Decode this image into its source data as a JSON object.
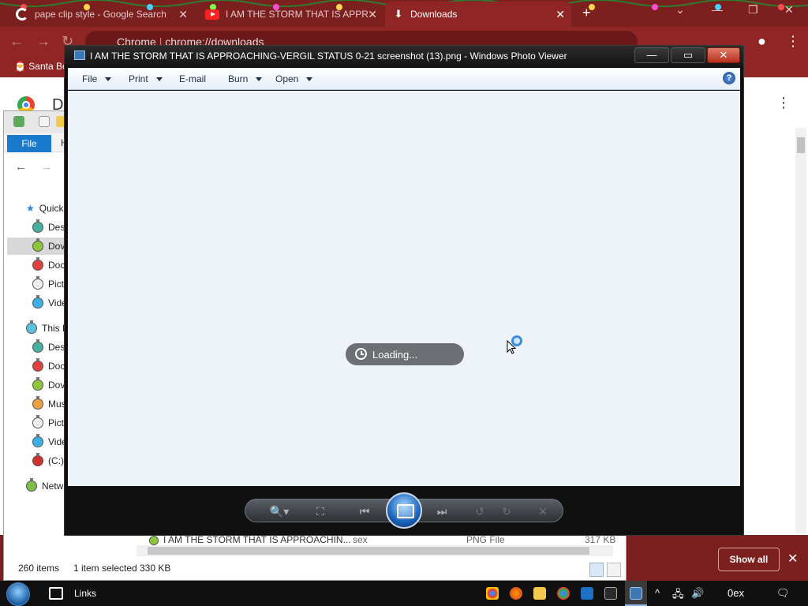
{
  "chrome": {
    "tabs": [
      {
        "title": "pape clip style - Google Search",
        "icon": "google-icon"
      },
      {
        "title": "I AM THE STORM THAT IS APPR",
        "icon": "youtube-icon"
      },
      {
        "title": "Downloads",
        "icon": "download-icon"
      }
    ],
    "new_tab": "+",
    "omnibox_chip": "Chrome",
    "omnibox_url": "chrome://downloads",
    "bookmark": "Santa Bo",
    "page_title": "D",
    "menu_glyph": "⋮",
    "show_all": "Show all",
    "close_glyph": "✕"
  },
  "explorer": {
    "ribbon_file": "File",
    "ribbon_tab2": "H",
    "quick_access": "Quick",
    "quick_items": [
      "Des",
      "Dov",
      "Doc",
      "Pict",
      "Vide"
    ],
    "this_pc": "This P",
    "pc_items": [
      "Des",
      "Doc",
      "Dov",
      "Mus",
      "Pict",
      "Vide",
      "(C:)"
    ],
    "network": "Netw",
    "list_row": {
      "name": "I AM THE STORM THAT IS APPROACHIN...",
      "tag": "sex",
      "type": "PNG File",
      "size": "317 KB"
    },
    "status_items": "260 items",
    "status_selected": "1 item selected",
    "status_size": "330 KB"
  },
  "photo_viewer": {
    "title": "I AM THE STORM THAT IS APPROACHING-VERGIL STATUS 0-21 screenshot (13).png - Windows Photo Viewer",
    "menu": {
      "file": "File",
      "print": "Print",
      "email": "E-mail",
      "burn": "Burn",
      "open": "Open"
    },
    "help": "?",
    "loading": "Loading...",
    "minimize": "—",
    "maximize": "▭",
    "close": "✕"
  },
  "taskbar": {
    "links": "Links",
    "clock": "0ex"
  },
  "colors": {
    "chrome_theme": "#8f2525",
    "photo_canvas": "#eef3fa",
    "explorer_file_tab": "#1979ca"
  }
}
